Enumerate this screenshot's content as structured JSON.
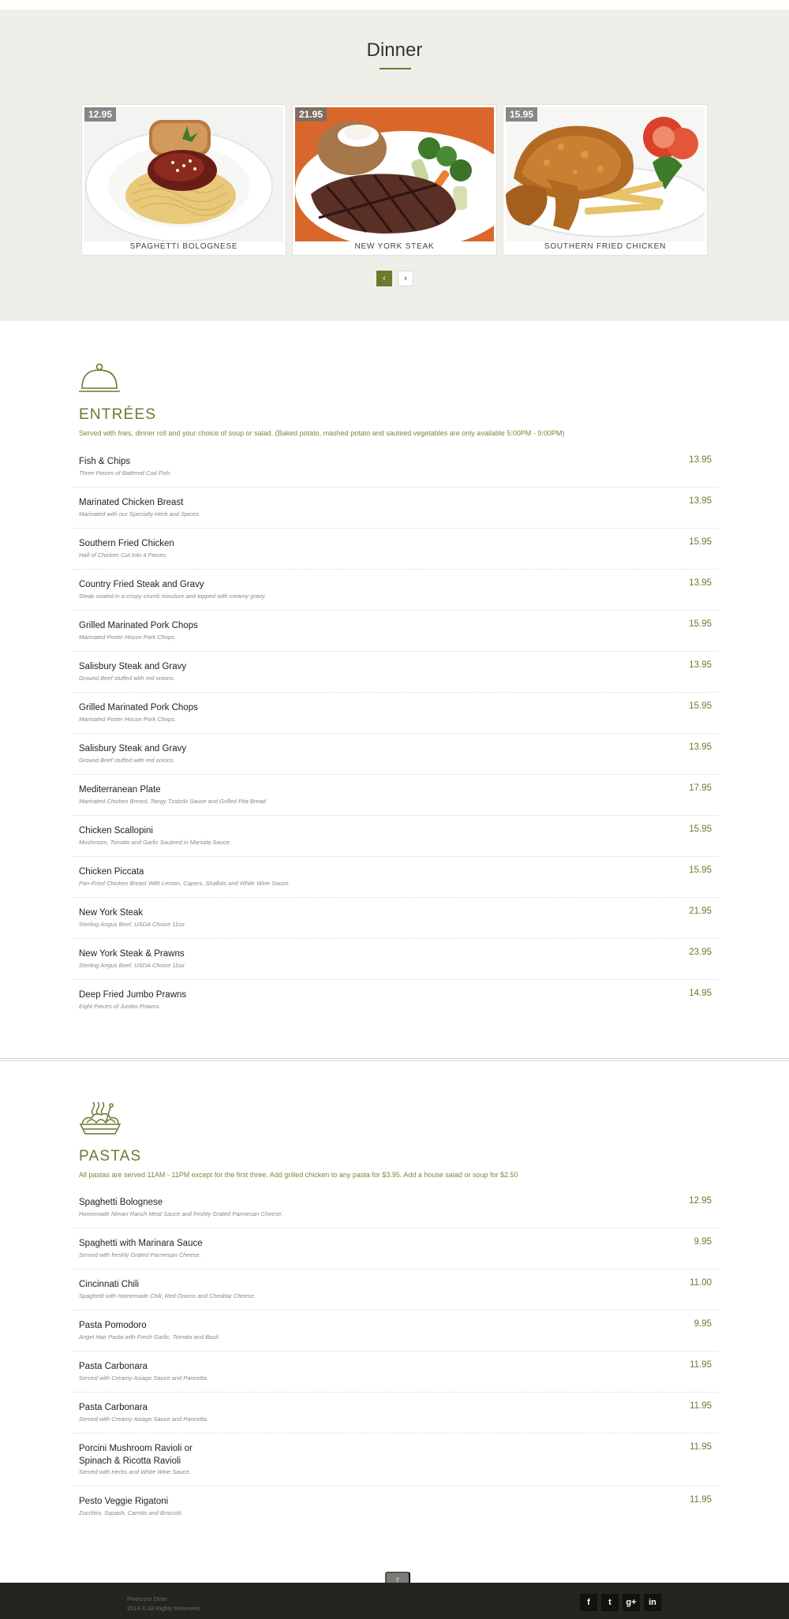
{
  "dinner": {
    "title": "Dinner",
    "cards": [
      {
        "price": "12.95",
        "name": "SPAGHETTI BOLOGNESE"
      },
      {
        "price": "21.95",
        "name": "NEW YORK STEAK"
      },
      {
        "price": "15.95",
        "name": "SOUTHERN FRIED CHICKEN"
      }
    ],
    "prev_icon": "‹",
    "next_icon": "›"
  },
  "entrees": {
    "title": "ENTRÉES",
    "icon": "cloche-icon",
    "description": "Served with fries, dinner roll and your choice of soup or salad. (Baked potato, mashed potato and sauteed vegetables are only available 5:00PM - 9:00PM)",
    "items": [
      {
        "name": "Fish & Chips",
        "desc": "Three Pieces of Battered Cod Fish.",
        "price": "13.95"
      },
      {
        "name": "Marinated Chicken Breast",
        "desc": "Marinated with our Specialty Herb and Spices.",
        "price": "13.95"
      },
      {
        "name": "Southern Fried Chicken",
        "desc": "Half of Chicken Cut Into 4 Pieces.",
        "price": "15.95"
      },
      {
        "name": "Country Fried Steak and Gravy",
        "desc": "Steak coated in a crispy crumb mixuture and topped with creamy gravy.",
        "price": "13.95"
      },
      {
        "name": "Grilled Marinated Pork Chops",
        "desc": "Marinated Porter House Pork Chops.",
        "price": "15.95"
      },
      {
        "name": "Salisbury Steak and Gravy",
        "desc": "Ground Beef stuffed with red onions.",
        "price": "13.95"
      },
      {
        "name": "Grilled Marinated Pork Chops",
        "desc": "Marinated Porter House Pork Chops.",
        "price": "15.95"
      },
      {
        "name": "Salisbury Steak and Gravy",
        "desc": "Ground Beef stuffed with red onions.",
        "price": "13.95"
      },
      {
        "name": "Mediterranean Plate",
        "desc": "Marinated Chicken Breast, Tangy Tzatziki Sauce and Grilled Pita Bread",
        "price": "17.95"
      },
      {
        "name": "Chicken Scallopini",
        "desc": "Mushroom, Tomato and Garlic Sauteed in Marsala Sauce.",
        "price": "15.95"
      },
      {
        "name": "Chicken Piccata",
        "desc": "Pan-Fried Chicken Breast With Lemon, Capers, Shallots and White Wine Sauce.",
        "price": "15.95"
      },
      {
        "name": "New York Steak",
        "desc": "Sterling Angus Beef, USDA Choice 11oz",
        "price": "21.95"
      },
      {
        "name": "New York Steak & Prawns",
        "desc": "Sterling Angus Beef, USDA Choice 11oz",
        "price": "23.95"
      },
      {
        "name": "Deep Fried Jumbo Prawns",
        "desc": "Eight Pieces of Jumbo Prawns.",
        "price": "14.95"
      }
    ]
  },
  "pastas": {
    "title": "PASTAS",
    "icon": "pasta-bowl-icon",
    "description": "All pastas are served 11AM - 11PM except for the first three. Add grilled chicken to any pasta for $3.95. Add a house salad or soup for $2.50",
    "items": [
      {
        "name": "Spaghetti Bolognese",
        "desc": "Homemade Nimari Ranch Meat Sauce and freshly Grated Parmesan Cheese.",
        "price": "12.95"
      },
      {
        "name": "Spaghetti with Marinara Sauce",
        "desc": "Served with freshly Grated Parmesan Cheese.",
        "price": "9.95"
      },
      {
        "name": "Cincinnati Chili",
        "desc": "Spaghetti with Homemade Chili, Red Onions and Cheddar Cheese.",
        "price": "11.00"
      },
      {
        "name": "Pasta Pomodoro",
        "desc": "Angel Hair Pasta with Fresh Garlic, Tomato and Basil.",
        "price": "9.95"
      },
      {
        "name": "Pasta Carbonara",
        "desc": "Served with Creamy Asiago Sauce and Pancetta.",
        "price": "11.95"
      },
      {
        "name": "Pasta Carbonara",
        "desc": "Served with Creamy Asiago Sauce and Pancetta.",
        "price": "11.95"
      },
      {
        "name_line1": "Porcini Mushroom Ravioli or",
        "name_line2": "Spinach & Ricotta Ravioli",
        "desc": "Served with Herbs and White Wine Sauce.",
        "price": "11.95"
      },
      {
        "name": "Pesto Veggie Rigatoni",
        "desc": "Zucchini, Squash, Carrots and Broccoli.",
        "price": "11.95"
      }
    ]
  },
  "footer": {
    "line1": "Pinecrest Diner",
    "line2": "2014 © All Rights Reserved.",
    "social": [
      {
        "icon": "facebook-icon",
        "glyph": "f"
      },
      {
        "icon": "twitter-icon",
        "glyph": "t"
      },
      {
        "icon": "google-plus-icon",
        "glyph": "g+"
      },
      {
        "icon": "linkedin-icon",
        "glyph": "in"
      }
    ],
    "to_top_icon": "↑"
  },
  "colors": {
    "accent": "#6b7a2f",
    "hero_bg": "#efeee9",
    "footer_bg": "#25241f"
  }
}
